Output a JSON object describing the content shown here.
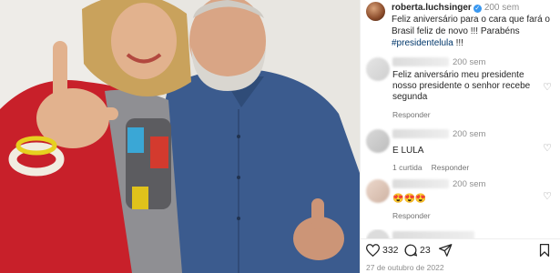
{
  "post": {
    "caption": {
      "username": "roberta.luchsinger",
      "time": "200 sem",
      "text": "Feliz aniversário para o cara que fará o Brasil feliz de novo !!! Parabéns ",
      "hashtag": "#presidentelula",
      "text_end": " !!!"
    },
    "comments": [
      {
        "time": "200 sem",
        "text": "Feliz aniversário meu presidente nosso presidente o senhor recebe segunda",
        "reply": "Responder",
        "likes": ""
      },
      {
        "time": "200 sem",
        "text": "E LULA",
        "reply": "Responder",
        "likes": "1 curtida"
      },
      {
        "time": "200 sem",
        "text": "😍😍😍",
        "reply": "Responder",
        "likes": ""
      }
    ],
    "actions": {
      "likes": "332",
      "comments": "23"
    },
    "date": "27 de outubro de 2022"
  },
  "icons": [
    "heart-icon",
    "comment-icon",
    "share-icon",
    "save-icon",
    "verified-icon"
  ],
  "colors": {
    "verified": "#3897f0",
    "hashtag": "#00376b",
    "muted": "#8e8e8e",
    "coat": "#c8202a",
    "shirt": "#3a5a8c"
  }
}
